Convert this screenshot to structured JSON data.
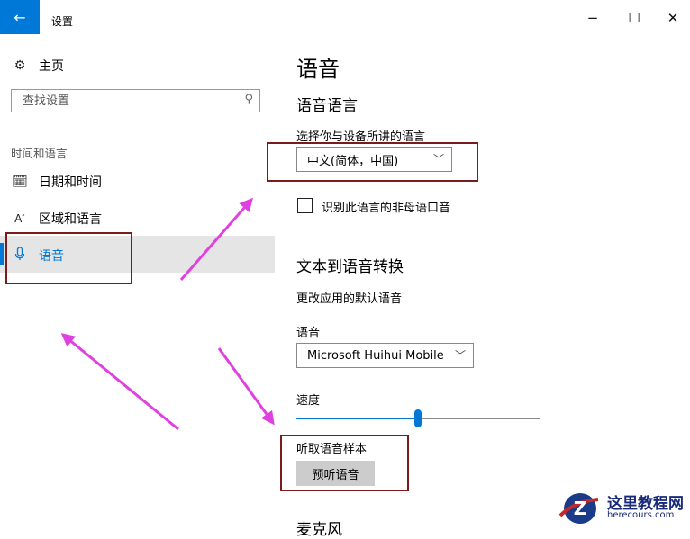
{
  "titlebar": {
    "back_icon": "arrow-left-icon",
    "title": "设置",
    "minimize": "−",
    "maximize": "☐",
    "close": "✕"
  },
  "sidebar": {
    "home": {
      "icon": "gear-icon",
      "label": "主页"
    },
    "search": {
      "placeholder": "查找设置",
      "icon": "search-icon"
    },
    "group_label": "时间和语言",
    "items": [
      {
        "icon": "calendar-clock-icon",
        "label": "日期和时间"
      },
      {
        "icon": "language-icon",
        "label": "区域和语言"
      },
      {
        "icon": "microphone-icon",
        "label": "语音",
        "selected": true
      }
    ]
  },
  "main": {
    "page_title": "语音",
    "speech_language": {
      "heading": "语音语言",
      "select_label": "选择你与设备所讲的语言",
      "select_value": "中文(简体，中国)",
      "checkbox_label": "识别此语言的非母语口音",
      "checkbox_checked": false
    },
    "tts": {
      "heading": "文本到语音转换",
      "default_voice_label": "更改应用的默认语音",
      "voice_label": "语音",
      "voice_value": "Microsoft Huihui Mobile",
      "speed_label": "速度",
      "speed_fraction": 0.5,
      "sample_label": "听取语音样本",
      "preview_button": "预听语音"
    },
    "bottom_heading_partial": "麦克风"
  },
  "annotation_color": "#e040e0",
  "highlight_color": "#7b1c1c",
  "accent_color": "#0078d7",
  "watermark": {
    "title": "这里教程网",
    "url": "herecours.com"
  }
}
